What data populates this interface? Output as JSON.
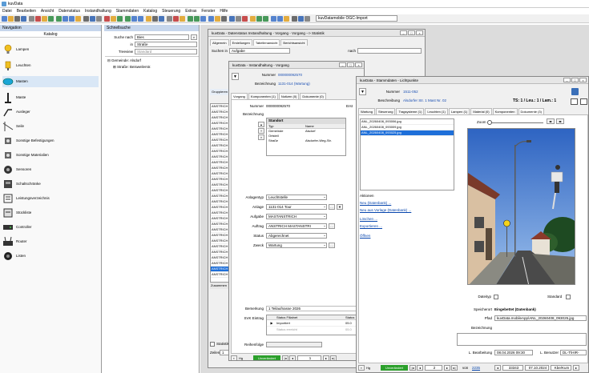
{
  "app": {
    "title": "kuvData"
  },
  "menu": [
    "Datei",
    "Bearbeiten",
    "Ansicht",
    "Datenstatus",
    "Instandhaltung",
    "Stammdaten",
    "Katalog",
    "Steuerung",
    "Extras",
    "Fenster",
    "Hilfe"
  ],
  "toolbar": {
    "select_value": "kuvDatamobile OGC-Import"
  },
  "navigation": {
    "title": "Navigation",
    "section": "Katalog",
    "items": [
      "Lampen",
      "Leuchten",
      "Masten",
      "Maste",
      "Ausleger",
      "Seile",
      "Sonstige Befestigungen",
      "Sonstige Materialien",
      "Sensoren",
      "Schaltschränke",
      "Leistungsverzeichnis",
      "Stückliste",
      "Controller",
      "Router",
      "Listen"
    ]
  },
  "quicksearch": {
    "title": "Schnellsuche",
    "search_label": "Suche nach",
    "search_value": "Bies",
    "in_label": "in",
    "in_value": "Straße",
    "treeview_label": "Treeview",
    "treeview_value": "Standard",
    "tree": [
      "Gemeinde: Alsdorf",
      "Straße: Beisweilerstr."
    ]
  },
  "win_stat": {
    "title": "kuvData - Datenstatus Instandhaltung - Vorgang - Vorgang --> Statistik",
    "tabs": [
      "Allgemein",
      "Erstellungen",
      "Tabellenansicht",
      "Berichtsansicht"
    ],
    "search_label": "Suchen in",
    "search_value": "Aufgabe",
    "nach_label": "nach",
    "group_label": "Gruppieren",
    "rows_prefix": "ANSTRICH",
    "zusammen": "Zusammen",
    "statistik_label": "Statistik",
    "zeilen_label": "Zeilen",
    "zeilen_value": "1"
  },
  "win_vorgang": {
    "title": "kuvData - Instandhaltung - Vorgang",
    "nummer_label": "Nummer",
    "nummer_value": "000000092570",
    "bez_label": "Bezeichnung",
    "bez_value": "1131-014 (Wartung)",
    "tabs": [
      "Vorgang",
      "Komponenten (1)",
      "Notizen (0)",
      "Dokumente (0)"
    ],
    "nummer2_label": "Nummer",
    "nummer2_value": "000000092570",
    "est_label": "Erst",
    "bezeichnung_label": "Bezeichnung",
    "standort": {
      "title": "Standort",
      "headers": [
        "Typ",
        "Name"
      ],
      "rows": [
        [
          "Gemeinde",
          "Alsdorf"
        ],
        [
          "Ortsteil",
          ""
        ],
        [
          "Straße",
          "Alsdorfer-Weg-Str."
        ]
      ]
    },
    "fields": [
      {
        "label": "Anlagentyp",
        "value": "Leuchtstelle"
      },
      {
        "label": "Anlage",
        "value": "1131-014 Tour"
      },
      {
        "label": "Aufgabe",
        "value": "MASTANSTRICH"
      },
      {
        "label": "Auftrag",
        "value": "ANSTRICH MASTANSTRI"
      },
      {
        "label": "Status",
        "value": "Abgerechnet"
      },
      {
        "label": "Zweck",
        "value": "Wartung"
      }
    ],
    "bemerkung_label": "Bemerkung",
    "bemerkung_value": "1 Teilaufnasse 2026",
    "svk_label": "SVK Eintrag",
    "svk_headers": [
      "Status Filialnet",
      "Status"
    ],
    "svk_rows": [
      [
        "Importiert",
        "05.0"
      ],
      [
        "Status erreicht",
        "05.0"
      ]
    ],
    "reihenfolge_label": "Reihenfolge",
    "green_label": "Unverändert",
    "record_value": "1"
  },
  "win_stamm": {
    "title": "kuvData - Stammdaten - Lichtpunkte",
    "nummer_label": "Nummer",
    "nummer_value": "1511-052",
    "beschreibung_label": "Beschreibung",
    "beschreibung_value": "Alsdorfer Str. 1 Mast Nr. 02",
    "ts_text": "TS: 1 / Leu.: 1 / Lam.: 1",
    "tabs": [
      "Wartung",
      "Steuerung",
      "Tragsysteme (1)",
      "Leuchten (1)",
      "Lampen (1)",
      "Material (0)",
      "Komponenten",
      "Dokumente (3)"
    ],
    "files": [
      "ANL_20260408_093006.jpg",
      "ANL_20260408_093009.jpg",
      "ANL_20260408_093025.jpg"
    ],
    "actions_title": "Aktionen",
    "actions": [
      "Neu (Datenbank) ...",
      "Neu aus Vorlage (Datenbank) ...",
      "Löschen ...",
      "Exportieren ...",
      "Öffnen"
    ],
    "zoom_label": "Zoom",
    "dateityp_label": "Dateityp",
    "standard_label": "Standard",
    "speicherort_label": "Speicherort",
    "speicherort_value": "Eingebettet (Datenbank)",
    "pfad_label": "Pfad",
    "pfad_value": "kuvData.mobileApp\\ANL_20260408_093025.jpg",
    "bezeichnung_label": "Bezeichnung",
    "lbearb_label": "L. Bearbeitung",
    "lbearb_value": "08.04.2026 09:30",
    "lbenutzer_label": "L. Benutzer",
    "lbenutzer_value": "DL-T\\HIR-",
    "green_label": "Unverändert",
    "record_value": "2",
    "von_label": "von",
    "von_value": "2235",
    "id_value": "33343",
    "date_value": "07.10.2024",
    "user_value": "Kbe/Kum"
  }
}
